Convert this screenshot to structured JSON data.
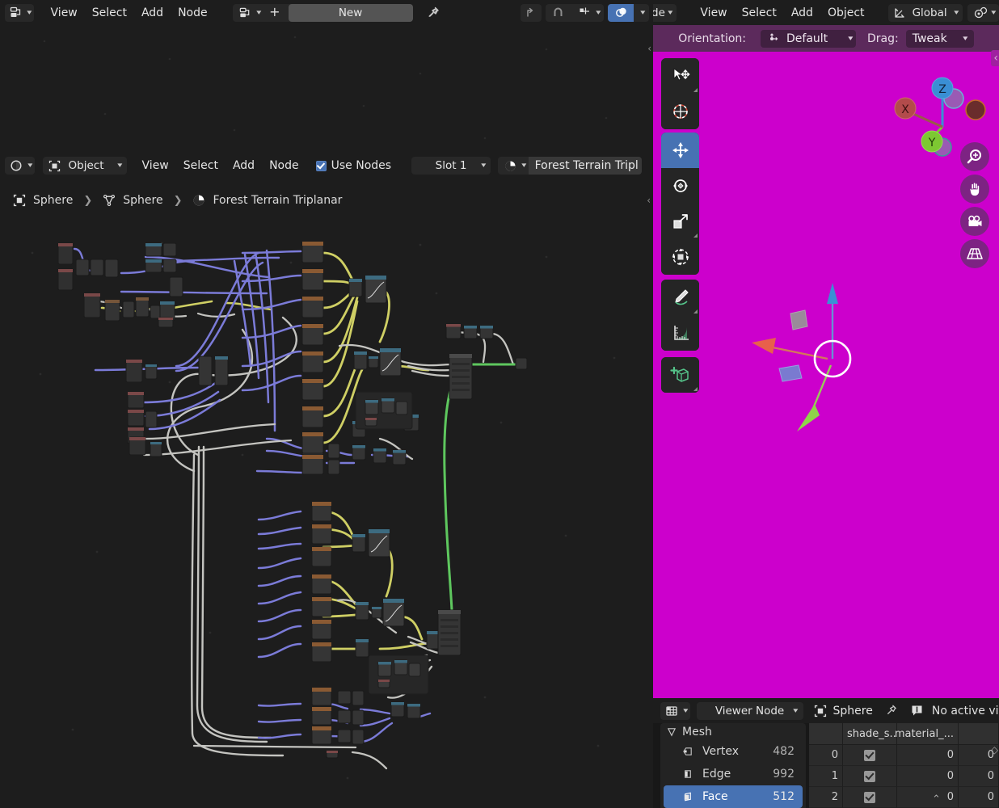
{
  "node_editor": {
    "header_top": {
      "editor_type_icon": "node-editor-icon",
      "menus": [
        "View",
        "Select",
        "Add",
        "Node"
      ],
      "datablock_icon": "node-tree-icon",
      "add_label": "+",
      "new_label": "New",
      "pin_icon": "pin-icon",
      "parent_icon": "go-to-parent-icon",
      "snap_icon": "snap-magnet-icon",
      "snap_target_icon": "snap-target-icon",
      "overlay_icon": "overlays-icon"
    },
    "header_mid": {
      "shader_type_icon": "shading-icon",
      "shader_type": "Object",
      "menus": [
        "View",
        "Select",
        "Add",
        "Node"
      ],
      "use_nodes_label": "Use Nodes",
      "use_nodes_checked": true,
      "slot_label": "Slot 1",
      "material_icon": "material-icon",
      "material_name": "Forest Terrain Tripl"
    },
    "breadcrumb": {
      "items": [
        {
          "icon": "object-icon",
          "label": "Sphere"
        },
        {
          "icon": "mesh-data-icon",
          "label": "Sphere"
        },
        {
          "icon": "material-icon",
          "label": "Forest Terrain Triplanar"
        }
      ],
      "collapse_icon": "chevron-left-icon"
    },
    "wire_colors": {
      "vector": "#7b7bd8",
      "color": "#c8c864",
      "shader": "#63c763",
      "value": "#c8c8c8"
    },
    "background": "#1d1d1d"
  },
  "viewport": {
    "header": {
      "mode_label": "de",
      "menus": [
        "View",
        "Select",
        "Add",
        "Object"
      ],
      "orientation_icon": "orientation-icon",
      "transform_orientation": "Global",
      "snap_icon": "snap-icon"
    },
    "tool_settings": {
      "orientation_label": "Orientation:",
      "orientation_icon": "transform-orientation-icon",
      "orientation_value": "Default",
      "drag_label": "Drag:",
      "drag_value": "Tweak"
    },
    "background_color": "#cc00cc",
    "toolbar": [
      {
        "name": "tweak-tool",
        "icon": "cursor-move-icon",
        "active": false
      },
      {
        "name": "cursor-tool",
        "icon": "3d-cursor-icon",
        "active": false
      },
      {
        "name": "move-tool",
        "icon": "move-arrows-icon",
        "active": true
      },
      {
        "name": "rotate-tool",
        "icon": "rotate-icon",
        "active": false
      },
      {
        "name": "scale-tool",
        "icon": "scale-icon",
        "active": false
      },
      {
        "name": "transform-tool",
        "icon": "transform-icon",
        "active": false
      },
      {
        "name": "annotate-tool",
        "icon": "pencil-icon",
        "active": false
      },
      {
        "name": "measure-tool",
        "icon": "ruler-icon",
        "active": false
      },
      {
        "name": "add-cube-tool",
        "icon": "add-cube-icon",
        "active": false
      }
    ],
    "gizmo_axes": [
      {
        "label": "X",
        "color": "#b34b4b"
      },
      {
        "label": "Y",
        "color": "#7dc832"
      },
      {
        "label": "Z",
        "color": "#3a8fd4"
      }
    ],
    "nav_buttons": [
      {
        "name": "zoom-button",
        "icon": "zoom-icon"
      },
      {
        "name": "pan-button",
        "icon": "hand-icon"
      },
      {
        "name": "camera-button",
        "icon": "camera-icon"
      },
      {
        "name": "perspective-button",
        "icon": "grid-perspective-icon"
      }
    ],
    "transform_gizmo": {
      "x_color": "#e8604b",
      "y_color": "#7dc832",
      "z_color": "#3a8fd4"
    }
  },
  "spreadsheet": {
    "header": {
      "editor_icon": "spreadsheet-icon",
      "dataset_label": "Viewer Node",
      "object_icon": "object-icon",
      "object_name": "Sphere",
      "pin_icon": "pin-icon",
      "info_icon": "info-icon",
      "status": "No active vi"
    },
    "domains": {
      "group_icon": "mesh-icon",
      "group_label": "Mesh",
      "rows": [
        {
          "icon": "vertex-icon",
          "label": "Vertex",
          "count": "482",
          "selected": false
        },
        {
          "icon": "edge-icon",
          "label": "Edge",
          "count": "992",
          "selected": false
        },
        {
          "icon": "face-icon",
          "label": "Face",
          "count": "512",
          "selected": true
        }
      ]
    },
    "table": {
      "columns": [
        "",
        "shade_s...",
        "material_...",
        ""
      ],
      "rows": [
        {
          "index": "0",
          "shade_smooth": true,
          "material_index": "0",
          "extra": "0"
        },
        {
          "index": "1",
          "shade_smooth": true,
          "material_index": "0",
          "extra": "0"
        },
        {
          "index": "2",
          "shade_smooth": true,
          "material_index": "0",
          "extra": "0"
        }
      ],
      "scroll_icon": "chevron-up-icon",
      "side_icon": "chevron-left-icon"
    }
  }
}
